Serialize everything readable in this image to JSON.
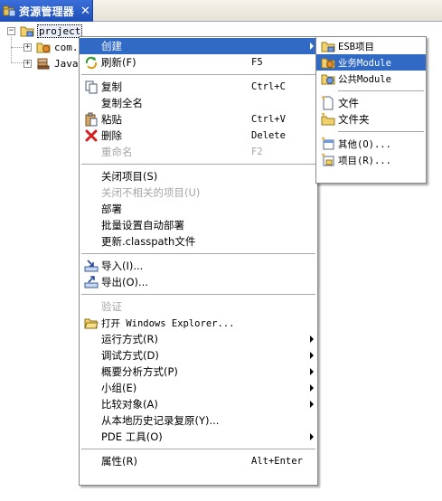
{
  "view": {
    "title": "资源管理器",
    "close_glyph": "✕",
    "icon": "package-explorer-icon"
  },
  "tree": {
    "root": {
      "expander": "−",
      "label": "project",
      "icon": "project-folder-icon"
    },
    "children": [
      {
        "expander": "+",
        "label": "com.",
        "icon": "package-icon"
      },
      {
        "expander": "+",
        "label": "Java",
        "icon": "java-library-icon"
      }
    ]
  },
  "context_menu": {
    "items": [
      {
        "label": "创建",
        "submenu": true,
        "active": true
      },
      {
        "label": "刷新(F)",
        "shortcut": "F5",
        "icon": "refresh-icon"
      },
      {
        "sep": true
      },
      {
        "label": "复制",
        "shortcut": "Ctrl+C",
        "icon": "copy-icon"
      },
      {
        "label": "复制全名"
      },
      {
        "label": "粘贴",
        "shortcut": "Ctrl+V",
        "icon": "paste-icon"
      },
      {
        "label": "删除",
        "shortcut": "Delete",
        "icon": "delete-icon"
      },
      {
        "label": "重命名",
        "shortcut": "F2",
        "disabled": true
      },
      {
        "sep": true
      },
      {
        "label": "关闭项目(S)"
      },
      {
        "label": "关闭不相关的项目(U)",
        "disabled": true
      },
      {
        "label": "部署"
      },
      {
        "label": "批量设置自动部署"
      },
      {
        "label": "更新.classpath文件"
      },
      {
        "sep": true
      },
      {
        "label": "导入(I)...",
        "icon": "import-icon"
      },
      {
        "label": "导出(O)...",
        "icon": "export-icon"
      },
      {
        "sep": true
      },
      {
        "label": "验证",
        "disabled": true
      },
      {
        "label": "打开 Windows Explorer...",
        "icon": "open-folder-icon"
      },
      {
        "label": "运行方式(R)",
        "submenu": true
      },
      {
        "label": "调试方式(D)",
        "submenu": true
      },
      {
        "label": "概要分析方式(P)",
        "submenu": true
      },
      {
        "label": "小组(E)",
        "submenu": true
      },
      {
        "label": "比较对象(A)",
        "submenu": true
      },
      {
        "label": "从本地历史记录复原(Y)..."
      },
      {
        "label": "PDE 工具(O)",
        "submenu": true
      },
      {
        "sep": true
      },
      {
        "label": "属性(R)",
        "shortcut": "Alt+Enter"
      }
    ]
  },
  "create_submenu": {
    "items": [
      {
        "label": "ESB项目",
        "icon": "esb-project-icon"
      },
      {
        "label": "业务Module",
        "icon": "business-module-icon",
        "active": true
      },
      {
        "label": "公共Module",
        "icon": "common-module-icon"
      },
      {
        "sep": true
      },
      {
        "label": "文件",
        "icon": "new-file-icon"
      },
      {
        "label": "文件夹",
        "icon": "new-folder-icon"
      },
      {
        "sep": true
      },
      {
        "label": "其他(O)...",
        "icon": "other-wizard-icon"
      },
      {
        "label": "项目(R)...",
        "icon": "new-project-icon"
      }
    ]
  },
  "colors": {
    "tab_active": "#2b5fcc",
    "menu_highlight": "#316ac5",
    "disabled_text": "#a6a6a6"
  }
}
